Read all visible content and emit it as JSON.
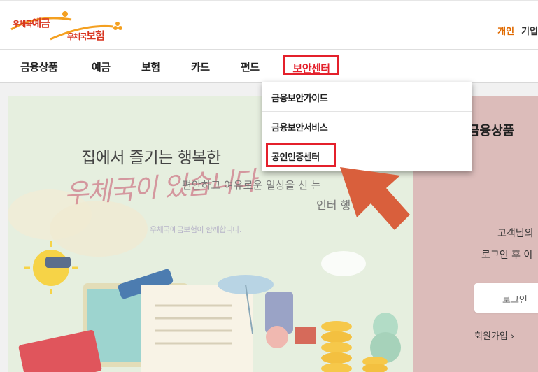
{
  "logo": {
    "yegeum_prefix": "우체국",
    "yegeum": "예금",
    "boheom_prefix": "우체국",
    "boheom": "보험"
  },
  "header": {
    "personal": "개인",
    "corporate": "기업"
  },
  "gnb": {
    "items": [
      "금융상품",
      "예금",
      "보험",
      "카드",
      "펀드"
    ],
    "active": "보안센터"
  },
  "dropdown": {
    "items": [
      "금융보안가이드",
      "금융보안서비스",
      "공인인증센터"
    ]
  },
  "banner": {
    "title": "집에서 즐기는 행복한",
    "subtitle1": "편안하고 여유로운 일상을 선",
    "subtitle1_end": "는",
    "subtitle2": "인터",
    "subtitle2_end": "행",
    "calligraphy": "우체국이 있습니다",
    "small": "우체국예금보험이 함께합니다."
  },
  "side": {
    "title": "금융상품",
    "text1": "고객님의",
    "text2": "로그인 후 이",
    "login": "로그인",
    "join": "회원가입 ›"
  },
  "colors": {
    "accent_red": "#e4202b",
    "personal_orange": "#e06a00",
    "arrow": "#d95f3c"
  }
}
